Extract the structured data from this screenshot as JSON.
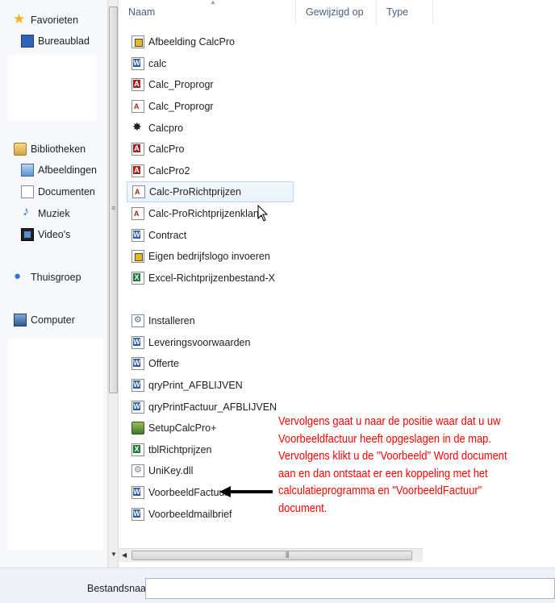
{
  "sidebar": {
    "items": [
      {
        "label": "Favorieten",
        "icon": "star-icon"
      },
      {
        "label": "Bureaublad",
        "icon": "desktop-icon"
      },
      {
        "label": "Bibliotheken",
        "icon": "library-icon"
      },
      {
        "label": "Afbeeldingen",
        "icon": "pictures-icon"
      },
      {
        "label": "Documenten",
        "icon": "documents-icon"
      },
      {
        "label": "Muziek",
        "icon": "music-icon"
      },
      {
        "label": "Video's",
        "icon": "video-icon"
      },
      {
        "label": "Thuisgroep",
        "icon": "homegroup-icon"
      },
      {
        "label": "Computer",
        "icon": "computer-icon"
      }
    ]
  },
  "columns": {
    "name": "Naam",
    "modified": "Gewijzigd op",
    "type": "Type"
  },
  "files": [
    {
      "name": "Afbeelding CalcPro",
      "icon": "image-file-icon"
    },
    {
      "name": "calc",
      "icon": "word-document-icon"
    },
    {
      "name": "Calc_Proprogr",
      "icon": "access-database-icon"
    },
    {
      "name": "Calc_Proprogr",
      "icon": "access-shortcut-icon"
    },
    {
      "name": "Calcpro",
      "icon": "application-icon"
    },
    {
      "name": "CalcPro",
      "icon": "access-database-icon"
    },
    {
      "name": "CalcPro2",
      "icon": "access-database-icon"
    },
    {
      "name": "Calc-ProRichtprijzen",
      "icon": "access-shortcut-icon"
    },
    {
      "name": "Calc-ProRichtprijzenklant",
      "icon": "access-shortcut-icon"
    },
    {
      "name": "Contract",
      "icon": "word-document-icon"
    },
    {
      "name": "Eigen bedrijfslogo invoeren",
      "icon": "image-file-icon"
    },
    {
      "name": "Excel-Richtprijzenbestand-X",
      "icon": "excel-document-icon"
    },
    {
      "name": "Installeren",
      "icon": "installer-icon"
    },
    {
      "name": "Leveringsvoorwaarden",
      "icon": "word-document-icon"
    },
    {
      "name": "Offerte",
      "icon": "word-document-icon"
    },
    {
      "name": "qryPrint_AFBLIJVEN",
      "icon": "word-document-icon"
    },
    {
      "name": "qryPrintFactuur_AFBLIJVEN",
      "icon": "word-document-icon"
    },
    {
      "name": "SetupCalcPro+",
      "icon": "setup-icon"
    },
    {
      "name": "tblRichtprijzen",
      "icon": "excel-document-icon"
    },
    {
      "name": "UniKey.dll",
      "icon": "dll-file-icon"
    },
    {
      "name": "VoorbeeldFactuur",
      "icon": "word-document-icon"
    },
    {
      "name": "Voorbeeldmailbrief",
      "icon": "word-document-icon"
    }
  ],
  "bottom": {
    "filename_label": "Bestandsnaam:",
    "filename_value": ""
  },
  "annotation": {
    "text": "Vervolgens gaat u naar de positie waar dat u uw\nVoorbeeldfactuur heeft opgeslagen in de map.\nVervolgens klikt u de \"Voorbeeld\" Word document\naan en dan ontstaat er een koppeling met het\ncalculatieprogramma en \"VoorbeeldFactuur\"\ndocument.",
    "color": "#ff0000"
  }
}
